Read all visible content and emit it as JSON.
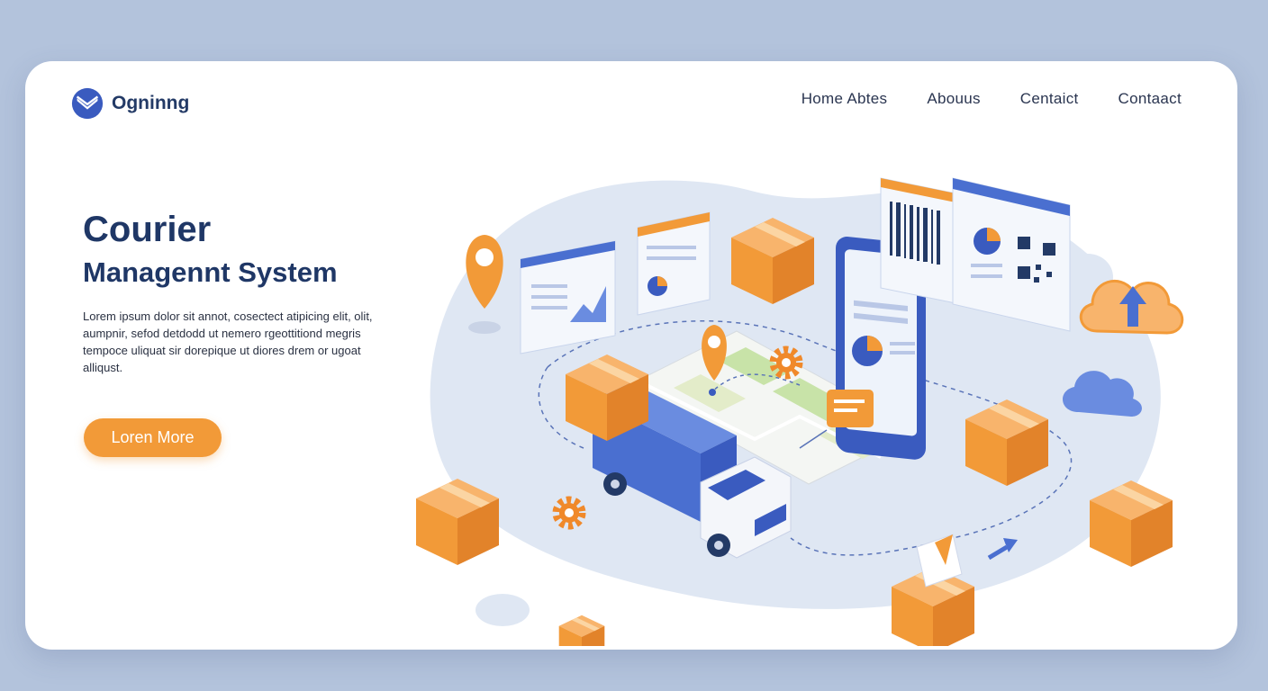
{
  "brand": {
    "name": "Ogninng",
    "logo_icon": "envelope-check-icon"
  },
  "nav": {
    "items": [
      "Home Abtes",
      "Abouus",
      "Centaict",
      "Contaact"
    ]
  },
  "hero": {
    "title_line1": "Courier",
    "title_line2": "Managennt System",
    "description": "Lorem ipsum dolor sit annot, cosectect atipicing elit, olit, aumpnir, sefod detdodd ut nemero rgeottitiond megris tempoce uliquat sir dorepique ut diores drem or ugoat alliqust.",
    "cta_label": "Loren More"
  },
  "colors": {
    "brand": "#3a5bbf",
    "accent": "#f29a38",
    "title": "#1f3766",
    "backdrop": "#b3c3dc"
  }
}
